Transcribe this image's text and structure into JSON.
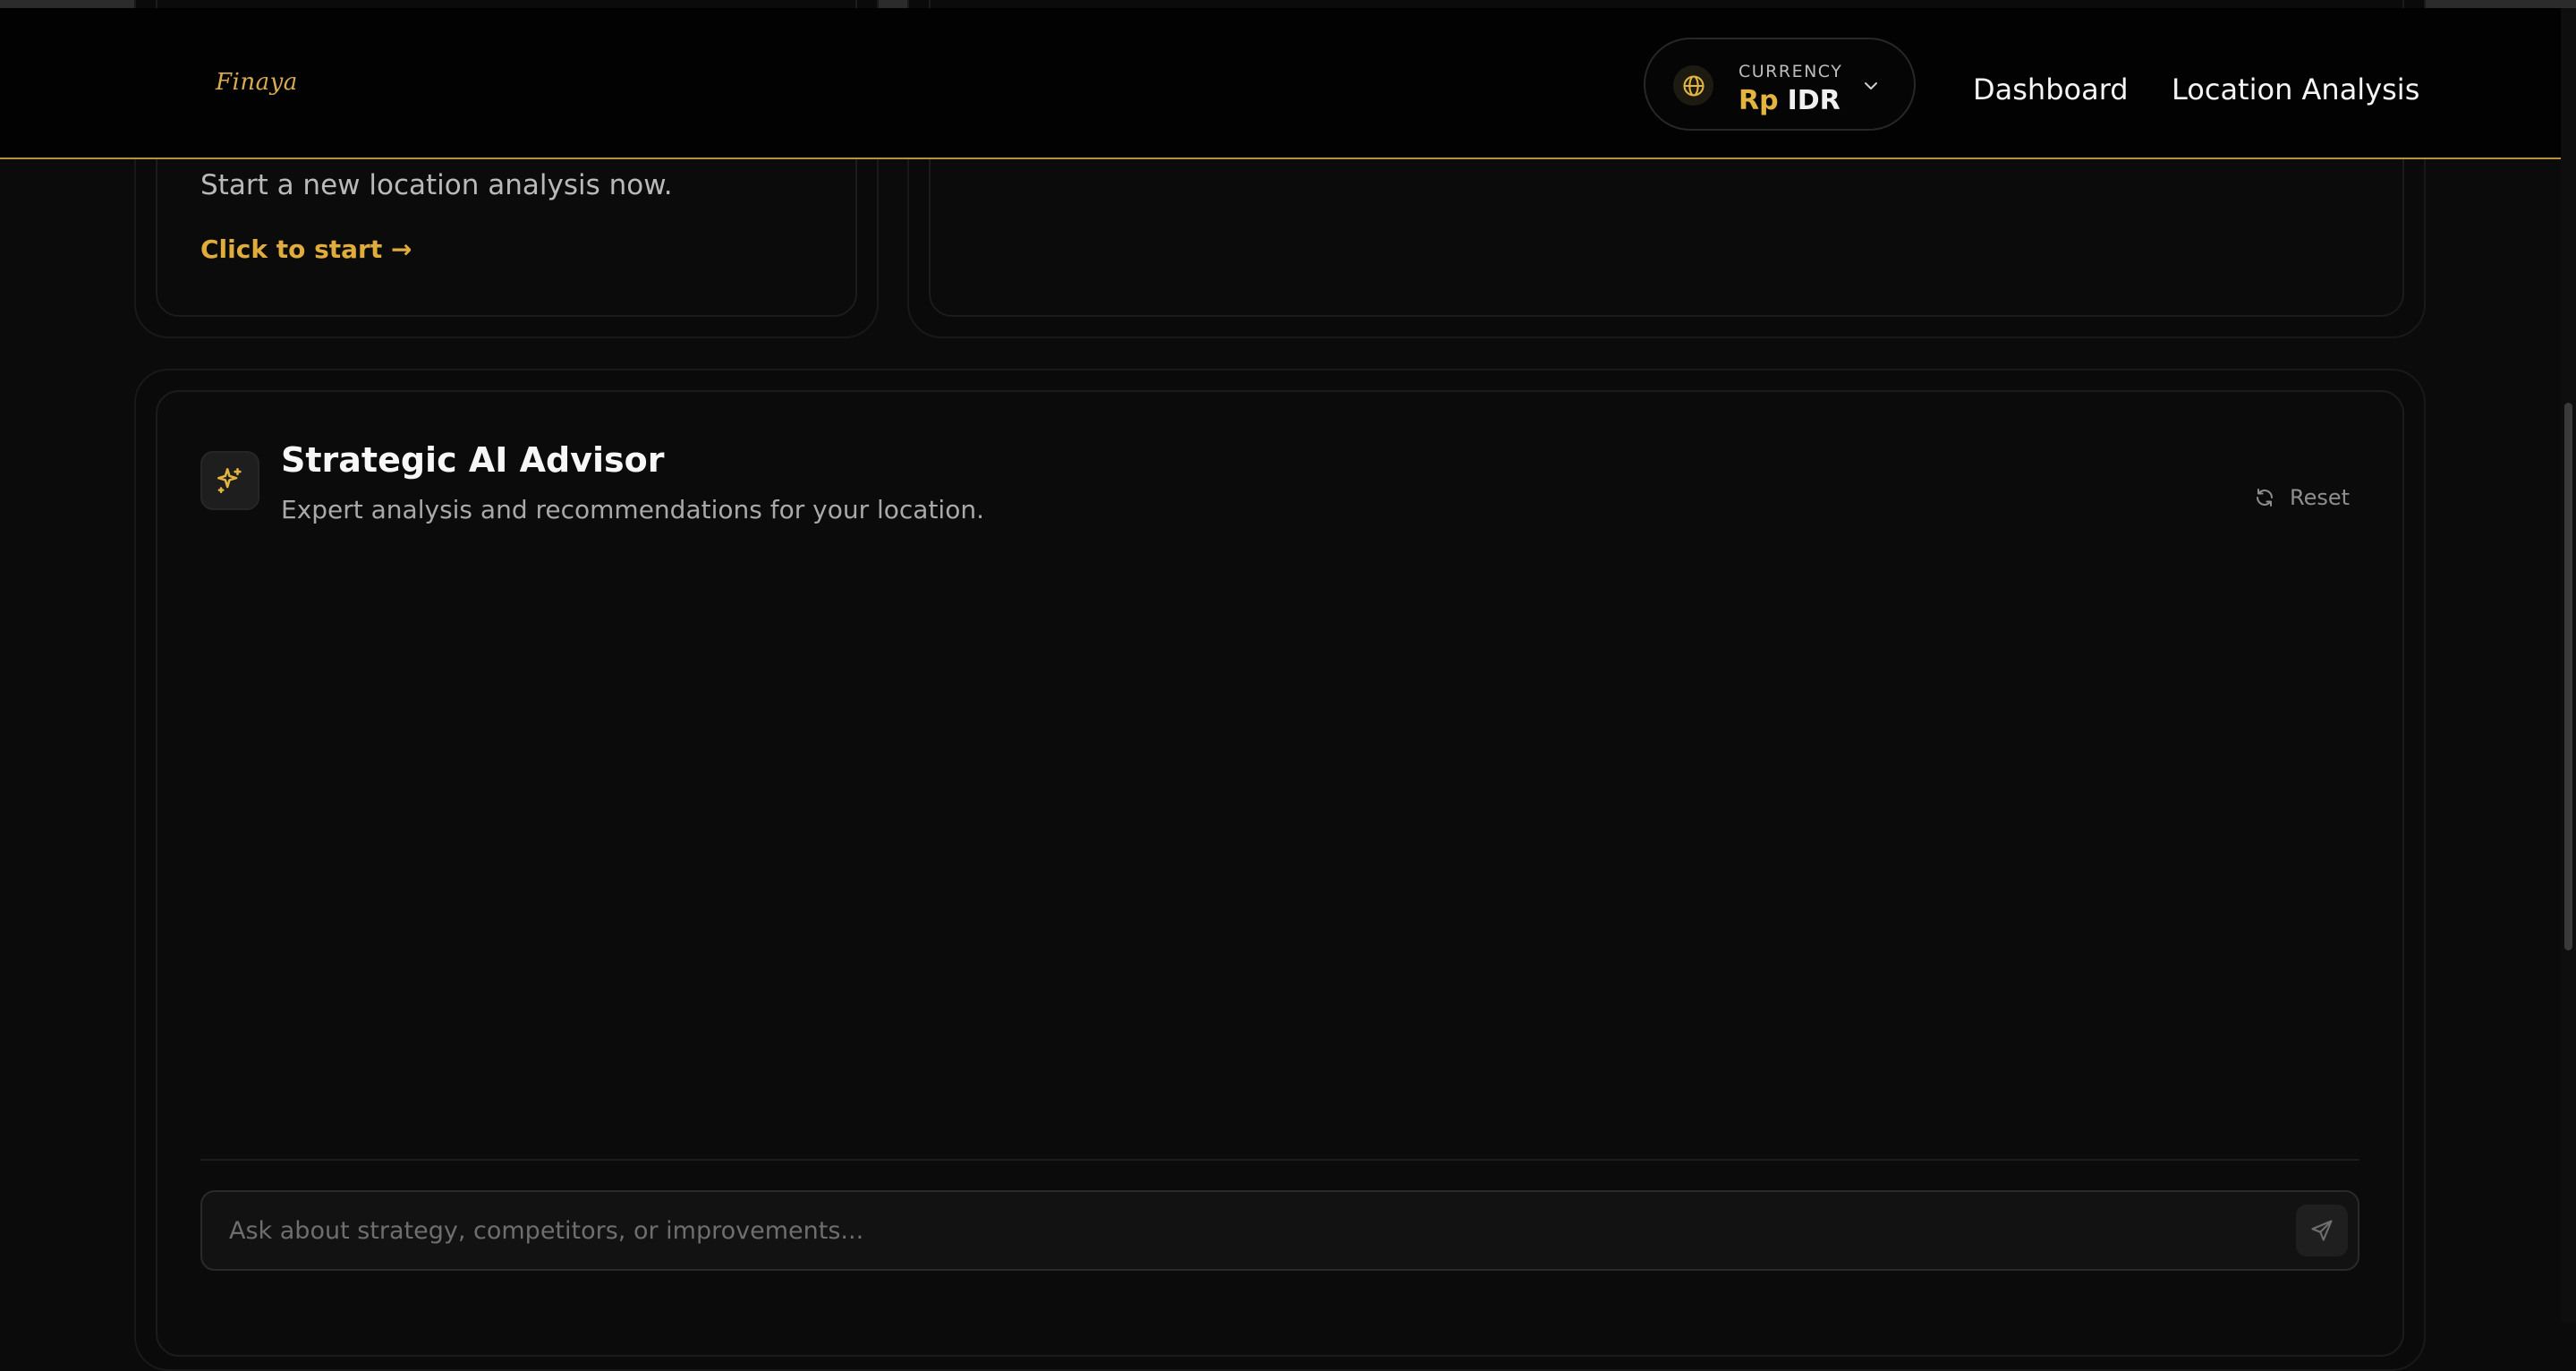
{
  "header": {
    "logo_text": "Finaya",
    "currency": {
      "label": "CURRENCY",
      "symbol": "Rp",
      "code": "IDR"
    },
    "nav": {
      "dashboard": "Dashboard",
      "location_analysis": "Location Analysis"
    }
  },
  "start_card": {
    "description": "Start a new location analysis now.",
    "cta": "Click to start →"
  },
  "advisor": {
    "title": "Strategic AI Advisor",
    "subtitle": "Expert analysis and recommendations for your location.",
    "reset_label": "Reset",
    "input_placeholder": "Ask about strategy, competitors, or improvements..."
  },
  "colors": {
    "accent": "#e0ac3c",
    "background": "#0b0b0b"
  }
}
